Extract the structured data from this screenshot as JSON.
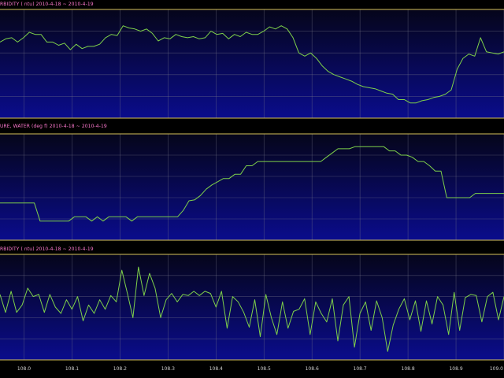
{
  "colors": {
    "trace": "#7fd14a",
    "frame": "#d6c25a",
    "grid": "#7a7a8a",
    "title": "#ff7ad0",
    "bg_top": "#05051a",
    "bg_bottom": "#0a0c8c"
  },
  "panels": [
    {
      "title": "RBIDITY ( ntu)  2010-4-18 ~ 2010-4-19",
      "y_range": [
        0,
        100
      ],
      "values": [
        70,
        73,
        74,
        70,
        74,
        79,
        77,
        77,
        70,
        70,
        67,
        69,
        63,
        68,
        64,
        66,
        66,
        68,
        74,
        77,
        76,
        85,
        83,
        82,
        80,
        82,
        78,
        71,
        74,
        73,
        77,
        75,
        74,
        75,
        73,
        74,
        80,
        77,
        78,
        73,
        77,
        75,
        79,
        77,
        77,
        80,
        84,
        82,
        85,
        82,
        74,
        60,
        57,
        60,
        55,
        48,
        43,
        40,
        38,
        36,
        34,
        31,
        29,
        28,
        27,
        25,
        23,
        22,
        17,
        17,
        14,
        14,
        16,
        17,
        19,
        20,
        22,
        26,
        45,
        55,
        59,
        57,
        74,
        61,
        60,
        59,
        61
      ]
    },
    {
      "title": "URE, WATER (deg f)  2010-4-18 ~ 2010-4-19",
      "y_range": [
        0,
        100
      ],
      "values": [
        35,
        35,
        35,
        35,
        35,
        35,
        35,
        18,
        18,
        18,
        18,
        18,
        18,
        22,
        22,
        22,
        18,
        22,
        18,
        22,
        22,
        22,
        22,
        18,
        22,
        22,
        22,
        22,
        22,
        22,
        22,
        22,
        28,
        37,
        38,
        42,
        48,
        52,
        55,
        58,
        58,
        62,
        62,
        70,
        70,
        74,
        74,
        74,
        74,
        74,
        74,
        74,
        74,
        74,
        74,
        74,
        74,
        78,
        82,
        86,
        86,
        86,
        88,
        88,
        88,
        88,
        88,
        88,
        84,
        84,
        80,
        80,
        78,
        74,
        74,
        70,
        65,
        65,
        40,
        40,
        40,
        40,
        40,
        44,
        44,
        44,
        44,
        44,
        44
      ]
    },
    {
      "title": "RBIDITY ( ntu)  2010-4-18 ~ 2010-4-19",
      "y_range": [
        0,
        100
      ],
      "values": [
        62,
        45,
        65,
        45,
        52,
        68,
        60,
        62,
        45,
        62,
        50,
        44,
        57,
        48,
        60,
        37,
        52,
        44,
        57,
        48,
        61,
        55,
        85,
        63,
        40,
        88,
        61,
        82,
        68,
        40,
        57,
        63,
        55,
        62,
        61,
        65,
        61,
        65,
        63,
        50,
        65,
        30,
        60,
        55,
        45,
        31,
        57,
        22,
        62,
        40,
        24,
        55,
        30,
        46,
        48,
        58,
        24,
        55,
        44,
        36,
        58,
        18,
        52,
        60,
        12,
        44,
        55,
        28,
        56,
        40,
        8,
        33,
        48,
        58,
        38,
        56,
        27,
        56,
        34,
        60,
        52,
        24,
        64,
        28,
        59,
        62,
        61,
        36,
        60,
        64,
        38,
        60
      ]
    }
  ],
  "x_axis": {
    "range": [
      107.95,
      109.0
    ],
    "ticks": [
      "108.0",
      "108.1",
      "108.2",
      "108.3",
      "108.4",
      "108.5",
      "108.6",
      "108.7",
      "108.8",
      "108.9",
      "109.0"
    ],
    "tick_values": [
      108.0,
      108.1,
      108.2,
      108.3,
      108.4,
      108.5,
      108.6,
      108.7,
      108.8,
      108.9,
      109.0
    ]
  }
}
